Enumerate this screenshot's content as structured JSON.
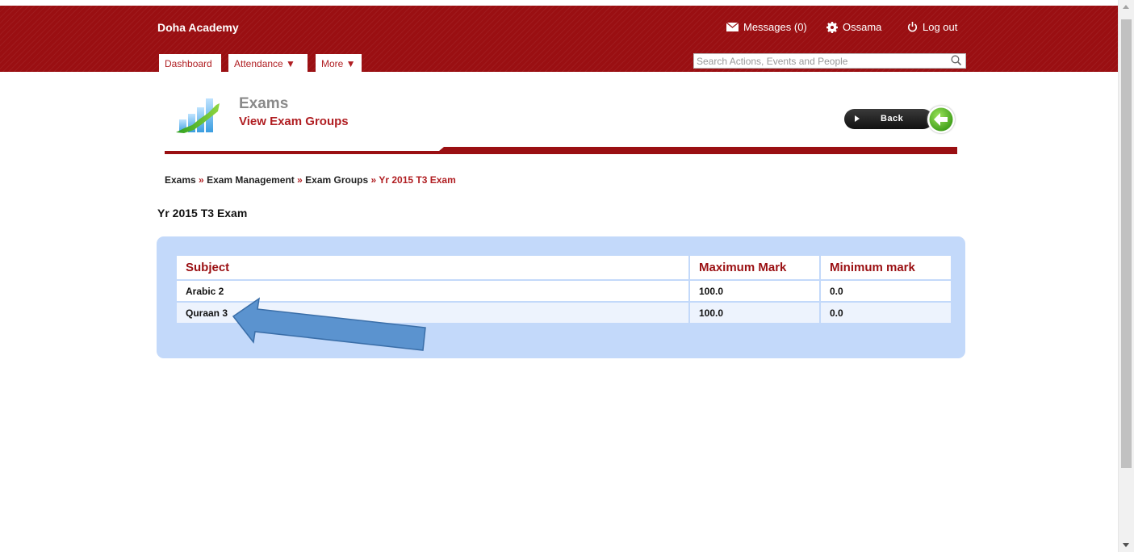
{
  "header": {
    "brand": "Doha Academy",
    "messages_label": "Messages (0)",
    "user_label": "Ossama",
    "logout_label": "Log out"
  },
  "nav": {
    "tabs": [
      {
        "label": "Dashboard"
      },
      {
        "label": "Attendance ▼"
      },
      {
        "label": "More ▼"
      }
    ],
    "search_placeholder": "Search Actions, Events and People"
  },
  "page": {
    "title": "Exams",
    "subtitle": "View Exam Groups",
    "back_label": "Back"
  },
  "breadcrumb": {
    "items": [
      "Exams",
      "Exam Management",
      "Exam Groups"
    ],
    "separator": "»",
    "current": "Yr 2015 T3 Exam"
  },
  "heading": "Yr 2015 T3 Exam",
  "table": {
    "headers": [
      "Subject",
      "Maximum Mark",
      "Minimum mark"
    ],
    "rows": [
      [
        "Arabic 2",
        "100.0",
        "0.0"
      ],
      [
        "Quraan 3",
        "100.0",
        "0.0"
      ]
    ]
  },
  "colors": {
    "brand_red": "#9a0f12",
    "panel_blue": "#c3d9fa",
    "annotation_arrow": "#5b93cf"
  },
  "icons": [
    "envelope-icon",
    "gear-icon",
    "power-icon",
    "search-icon",
    "chart-icon",
    "back-arrow-icon"
  ]
}
